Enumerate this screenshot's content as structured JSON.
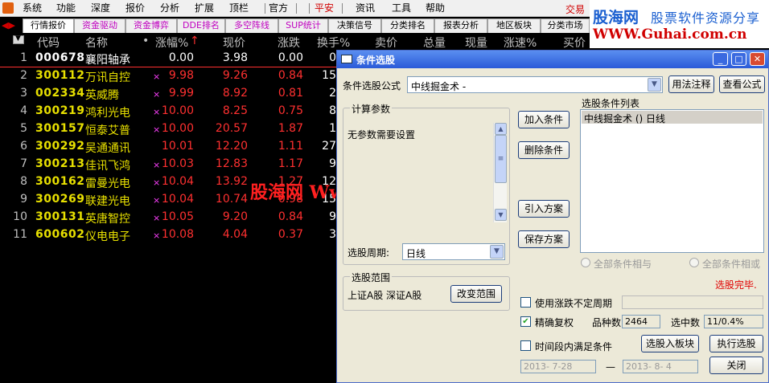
{
  "menu": {
    "items": [
      "系统",
      "功能",
      "深度",
      "报价",
      "分析",
      "扩展",
      "顶栏",
      "官方",
      "平安",
      "资讯",
      "工具",
      "帮助"
    ],
    "trade": "交易"
  },
  "watermark_top": {
    "line1a": "股海网",
    "line1b": "股票软件资源分享",
    "line2": "WWW.Guhai.com.cn"
  },
  "watermark_mid": "股海网 Www.Guhai.Com.CN",
  "tabs": [
    "行情报价",
    "资金驱动",
    "资金博弈",
    "DDE排名",
    "多空阵线",
    "SUP统计",
    "决策信号",
    "分类排名",
    "报表分析",
    "地区板块",
    "分类市场"
  ],
  "headers": [
    "代码",
    "名称",
    "•",
    "涨幅%",
    "↑",
    "现价",
    "涨跌",
    "换手%",
    "卖价",
    "总量",
    "现量",
    "涨速%",
    "买价"
  ],
  "rows": [
    {
      "n": "1",
      "code": "000678",
      "name": "襄阳轴承",
      "mark": "",
      "pct": "0.00",
      "price": "3.98",
      "chg": "0.00",
      "turn": "0"
    },
    {
      "n": "2",
      "code": "300112",
      "name": "万讯自控",
      "mark": "×",
      "pct": "9.98",
      "price": "9.26",
      "chg": "0.84",
      "turn": "15"
    },
    {
      "n": "3",
      "code": "002334",
      "name": "英威腾",
      "mark": "×",
      "pct": "9.99",
      "price": "8.92",
      "chg": "0.81",
      "turn": "2"
    },
    {
      "n": "4",
      "code": "300219",
      "name": "鸿利光电",
      "mark": "×",
      "pct": "10.00",
      "price": "8.25",
      "chg": "0.75",
      "turn": "8"
    },
    {
      "n": "5",
      "code": "300157",
      "name": "恒泰艾普",
      "mark": "×",
      "pct": "10.00",
      "price": "20.57",
      "chg": "1.87",
      "turn": "1"
    },
    {
      "n": "6",
      "code": "300292",
      "name": "吴通通讯",
      "mark": "",
      "pct": "10.01",
      "price": "12.20",
      "chg": "1.11",
      "turn": "27"
    },
    {
      "n": "7",
      "code": "300213",
      "name": "佳讯飞鸿",
      "mark": "×",
      "pct": "10.03",
      "price": "12.83",
      "chg": "1.17",
      "turn": "9"
    },
    {
      "n": "8",
      "code": "300162",
      "name": "雷曼光电",
      "mark": "×",
      "pct": "10.04",
      "price": "13.92",
      "chg": "1.27",
      "turn": "12"
    },
    {
      "n": "9",
      "code": "300269",
      "name": "联建光电",
      "mark": "×",
      "pct": "10.04",
      "price": "10.74",
      "chg": "0.98",
      "turn": "15"
    },
    {
      "n": "10",
      "code": "300131",
      "name": "英唐智控",
      "mark": "×",
      "pct": "10.05",
      "price": "9.20",
      "chg": "0.84",
      "turn": "9"
    },
    {
      "n": "11",
      "code": "600602",
      "name": "仪电电子",
      "mark": "×",
      "pct": "10.08",
      "price": "4.04",
      "chg": "0.37",
      "turn": "3"
    }
  ],
  "dialog": {
    "title": "条件选股",
    "formula_label": "条件选股公式",
    "formula_value": "中线掘金术 -",
    "usage_btn": "用法注释",
    "view_btn": "查看公式",
    "params_title": "计算参数",
    "params_text": "无参数需要设置",
    "add_btn": "加入条件",
    "del_btn": "删除条件",
    "import_btn": "引入方案",
    "save_btn": "保存方案",
    "list_title": "选股条件列表",
    "list_items": [
      "中线掘金术  ()  日线"
    ],
    "period_label": "选股周期:",
    "period_value": "日线",
    "radio_and": "全部条件相与",
    "radio_or": "全部条件相或",
    "status": "选股完毕.",
    "range_title": "选股范围",
    "range_text": "上证A股  深证A股",
    "change_range_btn": "改变范围",
    "use_period": "使用涨跌不定周期",
    "exact_adjust": "精确复权",
    "count_label": "品种数",
    "count_value": "2464",
    "selected_label": "选中数",
    "selected_value": "11/0.4%",
    "time_cond": "时间段内满足条件",
    "to_board_btn": "选股入板块",
    "run_btn": "执行选股",
    "date_from": "2013- 7-28",
    "date_sep": "—",
    "date_to": "2013- 8- 4",
    "close_btn": "关闭"
  }
}
